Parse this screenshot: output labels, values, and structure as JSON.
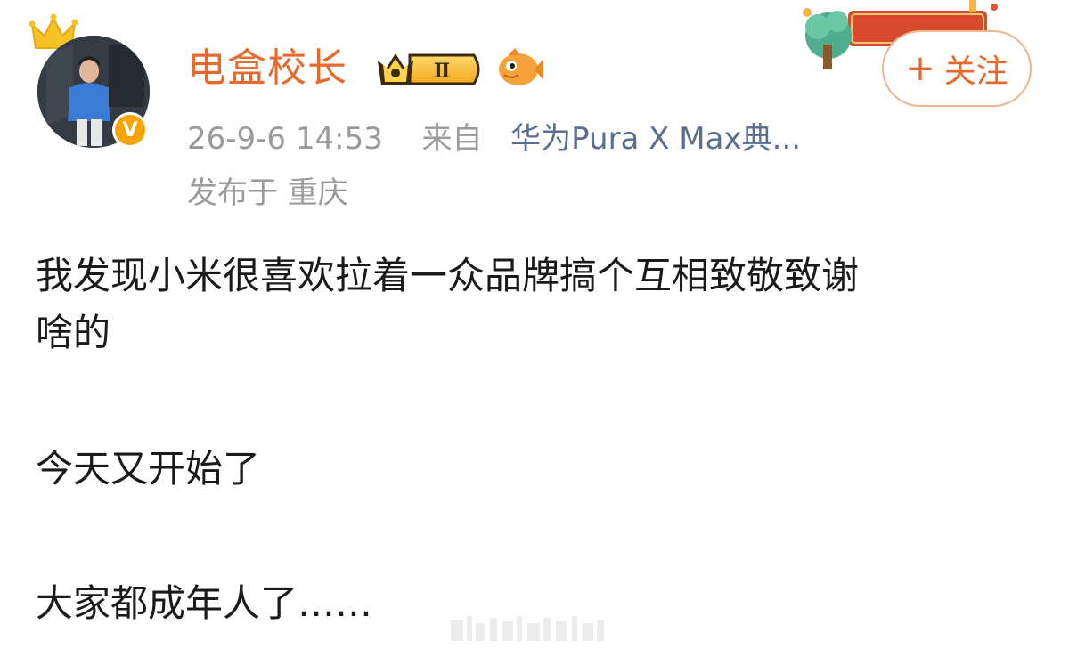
{
  "user": {
    "name": "电盒校长",
    "vip_level": "Ⅱ",
    "verified_mark": "V"
  },
  "meta": {
    "time": "26-9-6 14:53",
    "from_label": "来自",
    "source": "华为Pura X Max典...",
    "location": "发布于 重庆"
  },
  "follow": {
    "plus": "+",
    "label": "关注"
  },
  "post": {
    "line1": "我发现小米很喜欢拉着一众品牌搞个互相致敬致谢",
    "line2": "啥的",
    "line3": "今天又开始了",
    "line4": "大家都成年人了……"
  },
  "colors": {
    "username": "#e8692c",
    "meta": "#9a9a9a",
    "source": "#5a6e92",
    "follow_border": "#f0b48e",
    "v_badge": "#f6a400"
  },
  "icons": {
    "crown": "crown-icon",
    "verified": "verified-icon",
    "vip": "vip-level-icon",
    "fish": "fish-icon"
  }
}
